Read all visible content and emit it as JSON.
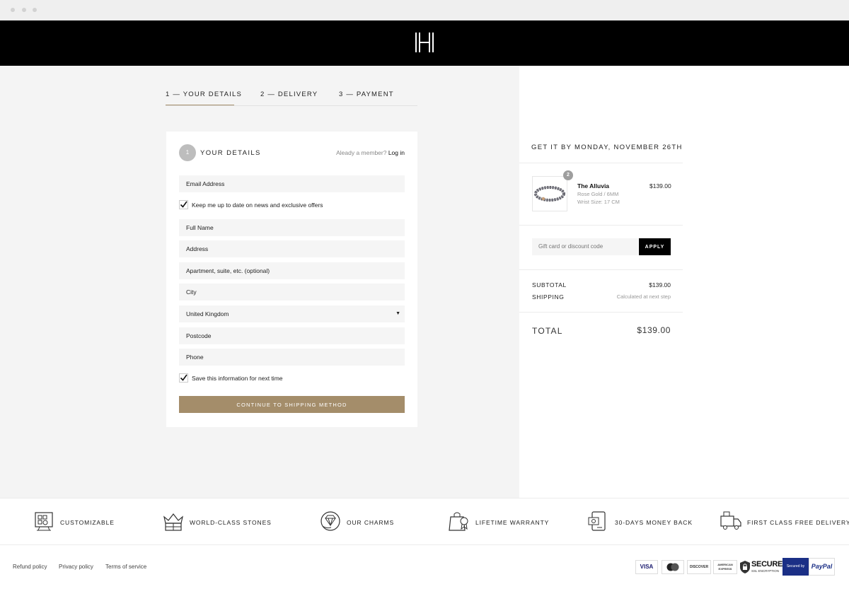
{
  "brand": {
    "logo_letter": "H"
  },
  "steps": [
    {
      "label": "1 — YOUR DETAILS",
      "active": true
    },
    {
      "label": "2 — DELIVERY",
      "active": false
    },
    {
      "label": "3 — PAYMENT",
      "active": false
    }
  ],
  "details": {
    "step_number": "1",
    "title": "YOUR DETAILS",
    "member_prompt": "Aleady a member?",
    "login_label": "Log in",
    "email_placeholder": "Email Address",
    "newsletter_label": "Keep me up to date on news and exclusive offers",
    "newsletter_checked": true,
    "full_name_placeholder": "Full Name",
    "address_placeholder": "Address",
    "apartment_placeholder": "Apartment, suite, etc. (optional)",
    "city_placeholder": "City",
    "country_value": "United Kingdom",
    "postcode_placeholder": "Postcode",
    "phone_placeholder": "Phone",
    "save_info_label": "Save this information for next time",
    "save_info_checked": true,
    "continue_label": "CONTINUE TO SHIPPING METHOD"
  },
  "order": {
    "delivery_heading": "GET IT BY MONDAY, NOVEMBER 26TH",
    "item": {
      "quantity": "2",
      "name": "The Alluvia",
      "variant": "Rose Gold / 6MM",
      "size": "Wrist Size: 17 CM",
      "price": "$139.00"
    },
    "discount_placeholder": "Gift card or discount code",
    "apply_label": "APPLY",
    "subtotal_label": "SUBTOTAL",
    "subtotal_value": "$139.00",
    "shipping_label": "SHIPPING",
    "shipping_value": "Calculated at next step",
    "total_label": "TOTAL",
    "total_value": "$139.00"
  },
  "features": [
    {
      "label": "CUSTOMIZABLE",
      "icon": "customize-icon"
    },
    {
      "label": "WORLD-CLASS STONES",
      "icon": "crown-gift-icon"
    },
    {
      "label": "OUR CHARMS",
      "icon": "diamond-hand-icon"
    },
    {
      "label": "LIFETIME WARRANTY",
      "icon": "warranty-bag-icon"
    },
    {
      "label": "30-DAYS MONEY BACK",
      "icon": "money-back-icon"
    },
    {
      "label": "FIRST CLASS FREE DELIVERY",
      "icon": "delivery-truck-icon"
    }
  ],
  "footer": {
    "links": [
      "Refund policy",
      "Privacy policy",
      "Terms of service"
    ],
    "payments": {
      "visa": "VISA",
      "discover": "DISCOVER",
      "amex": "AMERICAN EXPRESS",
      "secure": "SECURE",
      "secure_sub": "SSL ENCRYPTION",
      "paypal_secured": "Secured by",
      "paypal": "PayPal"
    }
  },
  "colors": {
    "accent_gold": "#a48d6a",
    "topbar": "#000000",
    "background_gray": "#f4f4f4"
  }
}
